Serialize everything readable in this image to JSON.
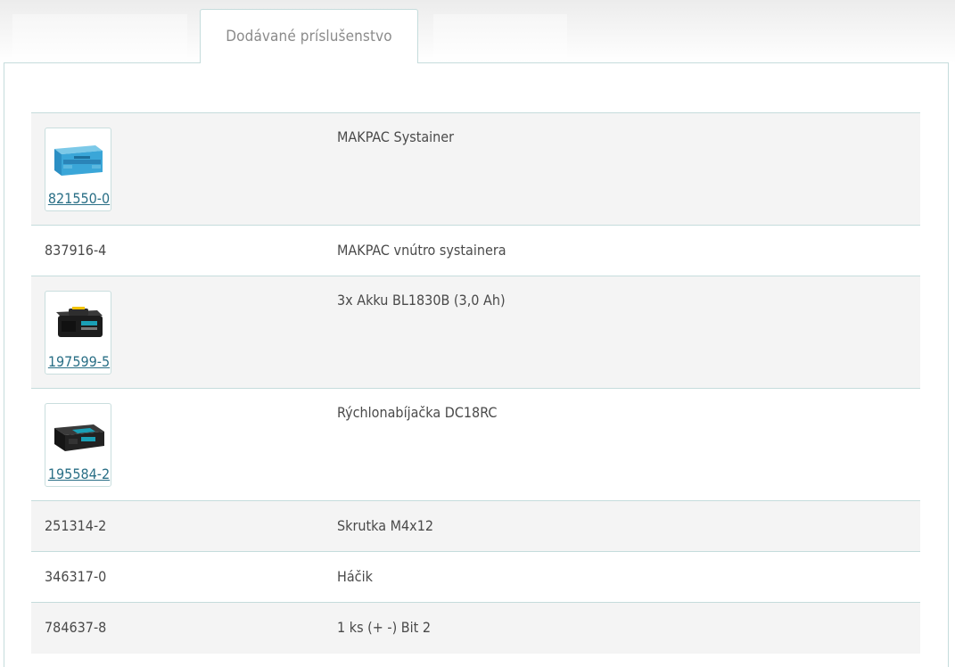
{
  "tabs": {
    "active_label": "Dodávané príslušenstvo"
  },
  "accessories": [
    {
      "code": "821550-0",
      "name": "MAKPAC Systainer",
      "image": "makpac-case-icon"
    },
    {
      "code": "837916-4",
      "name": "MAKPAC vnútro systainera"
    },
    {
      "code": "197599-5",
      "name": "3x Akku BL1830B (3,0 Ah)",
      "image": "battery-icon"
    },
    {
      "code": "195584-2",
      "name": "Rýchlonabíjačka DC18RC",
      "image": "charger-icon"
    },
    {
      "code": "251314-2",
      "name": "Skrutka M4x12"
    },
    {
      "code": "346317-0",
      "name": "Háčik"
    },
    {
      "code": "784637-8",
      "name": "1 ks (+ -) Bit 2"
    }
  ],
  "colors": {
    "link": "#2a6f86",
    "border": "#c5dcdc",
    "row_alt": "#f4f4f4",
    "makita_teal": "#1a9fb5"
  }
}
